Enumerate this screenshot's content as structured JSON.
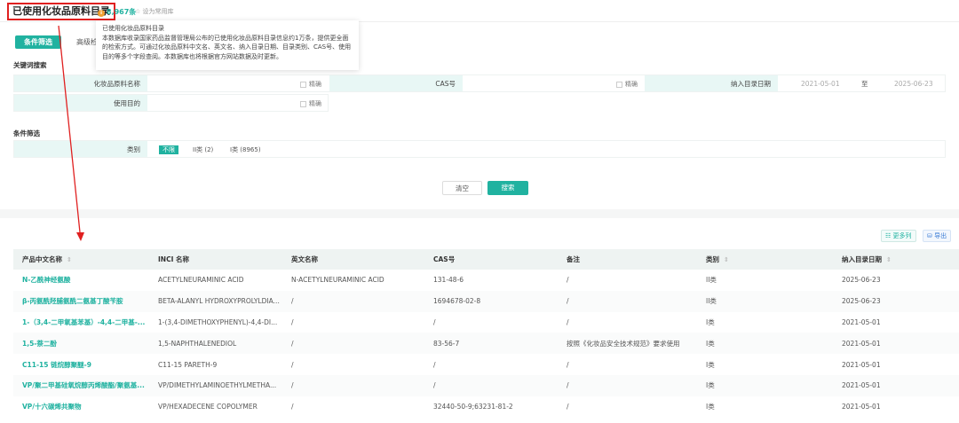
{
  "header": {
    "title": "已使用化妆品原料目录",
    "count": "8,967条",
    "count_icon": "info-icon",
    "favorite": "设为常用库"
  },
  "tooltip": {
    "title": "已使用化妆品原料目录",
    "body": "本数据库收录国家药品监督管理局公布的已使用化妆品原料目录信息约1万条，提供更全面的检索方式。可通过化妆品原料中文名、英文名、纳入目录日期、目录类别、CAS号、使用目的等多个字段查阅。本数据库也将根据官方网站数据及时更新。"
  },
  "tabs": [
    "条件筛选",
    "高级检索"
  ],
  "keyword": {
    "section": "关键词搜索",
    "name_label": "化妆品原料名称",
    "cas_label": "CAS号",
    "date_label": "纳入目录日期",
    "date_from": "2021-05-01",
    "date_sep": "至",
    "date_to": "2025-06-23",
    "purpose_label": "使用目的",
    "exact": "精确"
  },
  "filter": {
    "section": "条件筛选",
    "category_label": "类别",
    "options": [
      "不限",
      "II类 (2)",
      "I类 (8965)"
    ]
  },
  "buttons": {
    "clear": "清空",
    "search": "搜索"
  },
  "toolbar": {
    "more_columns": "更多列",
    "export": "导出"
  },
  "table": {
    "columns": [
      "产品中文名称",
      "INCI 名称",
      "英文名称",
      "CAS号",
      "备注",
      "类别",
      "纳入目录日期"
    ],
    "rows": [
      [
        "N-乙酰神经氨酸",
        "ACETYLNEURAMINIC ACID",
        "N-ACETYLNEURAMINIC ACID",
        "131-48-6",
        "/",
        "II类",
        "2025-06-23"
      ],
      [
        "β-丙氨酰羟脯氨酰二氨基丁酸苄胺",
        "BETA-ALANYL HYDROXYPROLYLDIA...",
        "/",
        "1694678-02-8",
        "/",
        "II类",
        "2025-06-23"
      ],
      [
        "1-（3,4-二甲氧基苯基）-4,4-二甲基-...",
        "1-(3,4-DIMETHOXYPHENYL)-4,4-DI...",
        "/",
        "/",
        "/",
        "I类",
        "2021-05-01"
      ],
      [
        "1,5-萘二酚",
        "1,5-NAPHTHALENEDIOL",
        "/",
        "83-56-7",
        "按照《化妆品安全技术规范》要求使用",
        "I类",
        "2021-05-01"
      ],
      [
        "C11-15 链烷醇聚醚-9",
        "C11-15 PARETH-9",
        "/",
        "/",
        "/",
        "I类",
        "2021-05-01"
      ],
      [
        "VP/聚二甲基硅氧烷醇丙烯酸酯/聚氨基...",
        "VP/DIMETHYLAMINOETHYLMETHA...",
        "/",
        "/",
        "/",
        "I类",
        "2021-05-01"
      ],
      [
        "VP/十六碳烯共聚物",
        "VP/HEXADECENE COPOLYMER",
        "/",
        "32440-50-9;63231-81-2",
        "/",
        "I类",
        "2021-05-01"
      ]
    ]
  },
  "colors": {
    "accent": "#20b2a0",
    "annotation": "#e02020"
  }
}
